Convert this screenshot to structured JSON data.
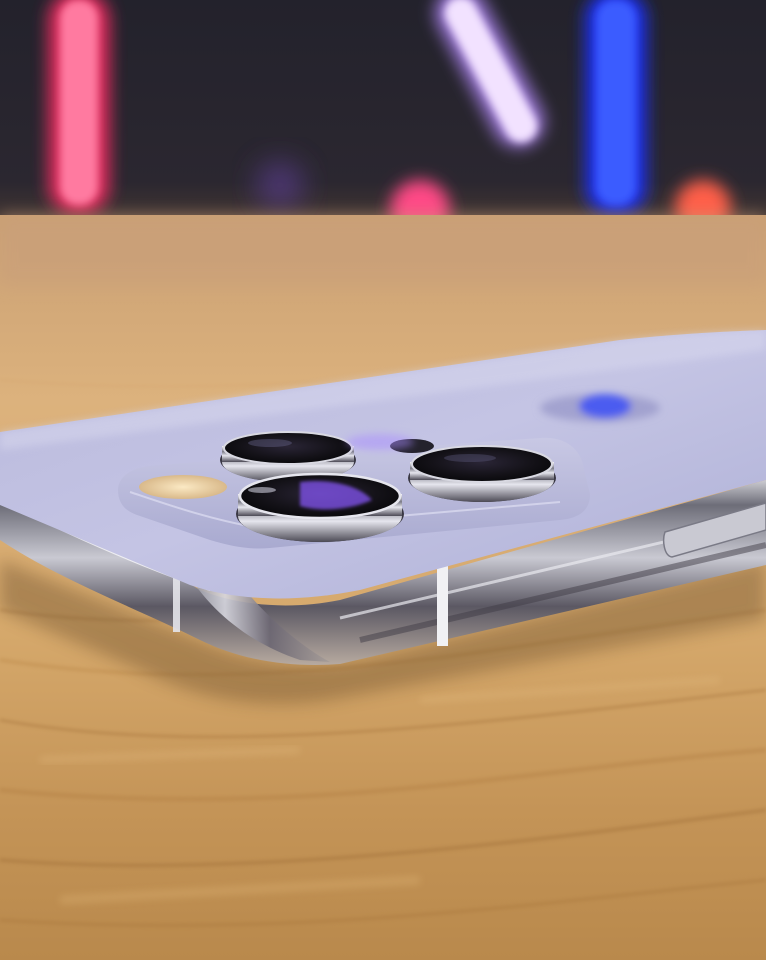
{
  "image": {
    "subject": "smartphone-camera-module-closeup",
    "colors": {
      "backdrop_dark": "#1c1c26",
      "table_light": "#e3b77d",
      "table_mid": "#c99a5c",
      "table_dark": "#a7773f",
      "phone_back": "#b3b3d6",
      "phone_back_light": "#c9c9e6",
      "frame_steel": "#8a8a96",
      "lens_black": "#101014",
      "neon_pink": "#ff3a6e",
      "neon_lavender": "#e8c8ff",
      "neon_blue": "#2746ff",
      "bokeh_orange": "#ff6a4a",
      "flash_warm": "#f3dcb0"
    }
  }
}
